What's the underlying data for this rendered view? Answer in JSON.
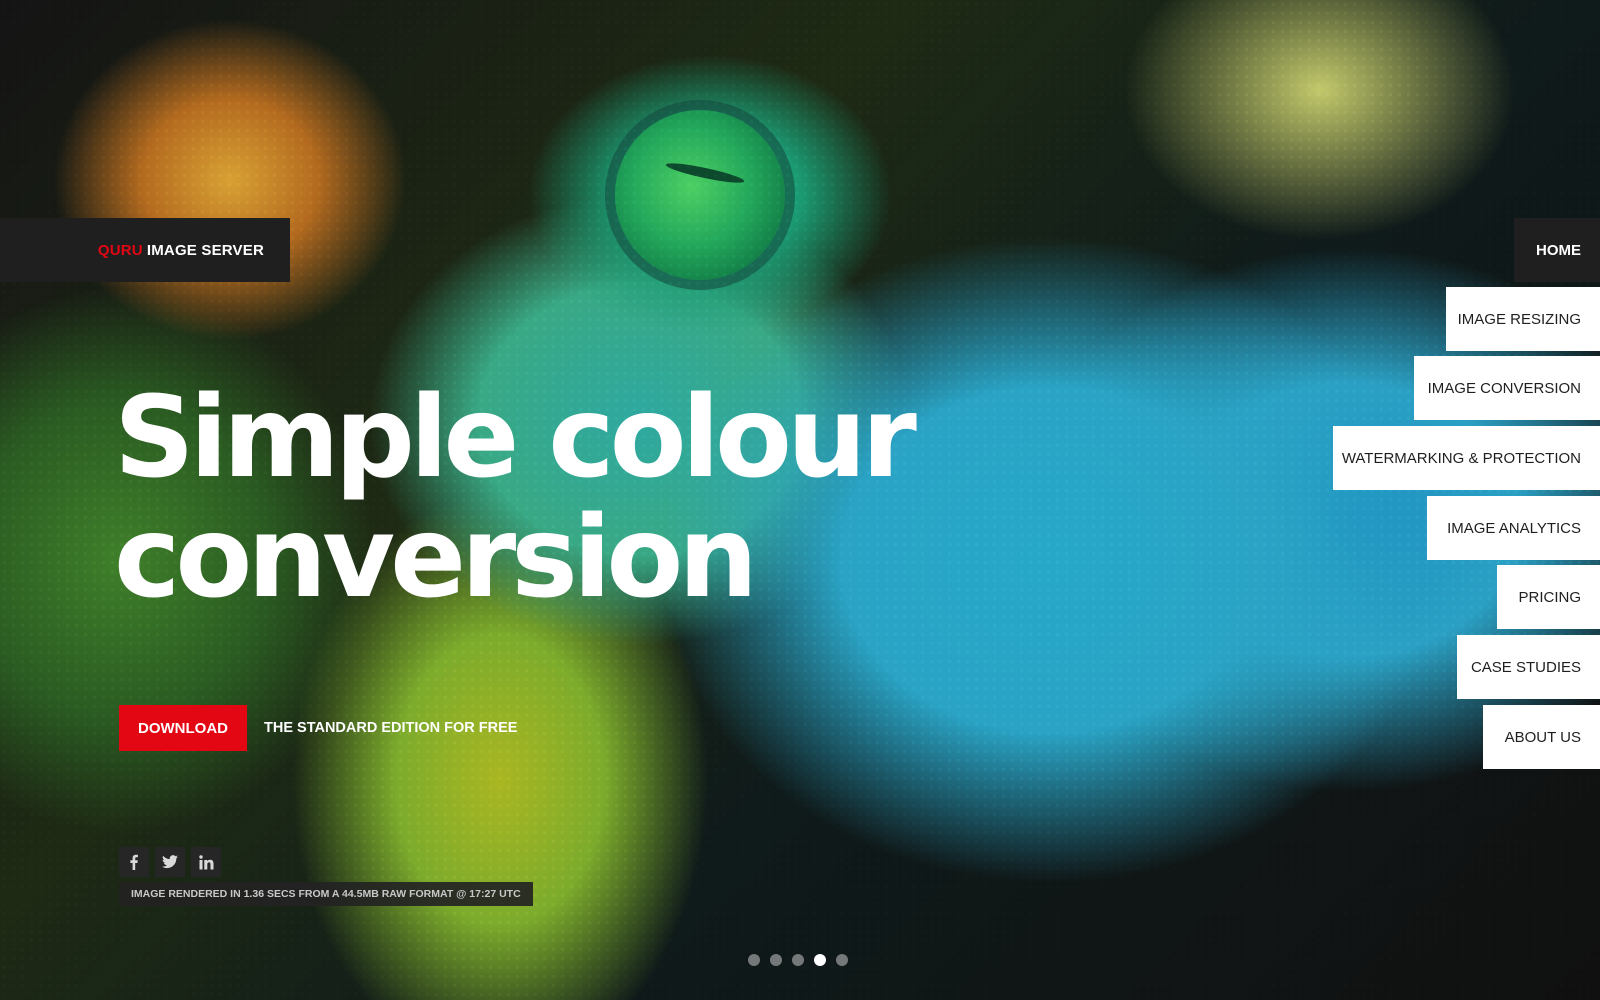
{
  "logo": {
    "brand_red": "QURU",
    "brand_white": "IMAGE SERVER"
  },
  "nav": {
    "items": [
      {
        "label": "HOME",
        "active": true
      },
      {
        "label": "IMAGE RESIZING",
        "active": false
      },
      {
        "label": "IMAGE CONVERSION",
        "active": false
      },
      {
        "label": "WATERMARKING & PROTECTION",
        "active": false
      },
      {
        "label": "IMAGE ANALYTICS",
        "active": false
      },
      {
        "label": "PRICING",
        "active": false
      },
      {
        "label": "CASE STUDIES",
        "active": false
      },
      {
        "label": "ABOUT US",
        "active": false
      }
    ]
  },
  "hero": {
    "headline_line1": "Simple colour",
    "headline_line2": "conversion",
    "background_icon": "chameleon-photo"
  },
  "cta": {
    "download_label": "DOWNLOAD",
    "note": "THE STANDARD EDITION FOR FREE"
  },
  "social": {
    "items": [
      {
        "icon": "facebook-icon"
      },
      {
        "icon": "twitter-icon"
      },
      {
        "icon": "linkedin-icon"
      }
    ]
  },
  "render_info": "IMAGE RENDERED IN 1.36 SECS FROM A 44.5MB RAW FORMAT @ 17:27 UTC",
  "slider": {
    "total": 5,
    "active_index": 4
  },
  "colors": {
    "accent": "#e30613",
    "dark": "#1f1f1f",
    "nav_bg": "#ffffff"
  }
}
